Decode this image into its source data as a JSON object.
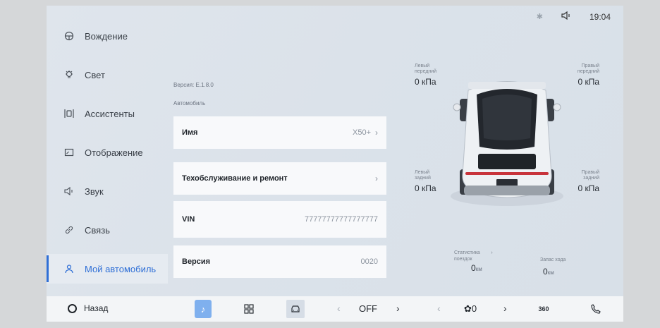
{
  "status": {
    "time": "19:04",
    "bluetooth_icon": "bluetooth-icon",
    "volume_icon": "volume-icon"
  },
  "sidebar": {
    "items": [
      {
        "label": "Вождение",
        "icon": "steering-wheel-icon"
      },
      {
        "label": "Свет",
        "icon": "light-bulb-icon"
      },
      {
        "label": "Ассистенты",
        "icon": "assistant-icon"
      },
      {
        "label": "Отображение",
        "icon": "display-icon"
      },
      {
        "label": "Звук",
        "icon": "speaker-icon"
      },
      {
        "label": "Связь",
        "icon": "link-icon"
      },
      {
        "label": "Мой автомобиль",
        "icon": "user-icon",
        "active": true
      }
    ]
  },
  "content": {
    "version_caption": "Версия: E.1.8.0",
    "section_caption": "Автомобиль",
    "rows": [
      {
        "title": "Имя",
        "value": "X50+",
        "chevron": true
      },
      {
        "title": "Техобслуживание и ремонт",
        "value": "",
        "chevron": true
      },
      {
        "title": "VIN",
        "value": "77777777777777777",
        "chevron": false
      },
      {
        "title": "Версия",
        "value": "0020",
        "chevron": false
      }
    ]
  },
  "tires": {
    "front_left": {
      "label1": "Левый",
      "label2": "передний",
      "value": "0 кПа"
    },
    "front_right": {
      "label1": "Правый",
      "label2": "передний",
      "value": "0 кПа"
    },
    "rear_left": {
      "label1": "Левый",
      "label2": "задний",
      "value": "0 кПа"
    },
    "rear_right": {
      "label1": "Правый",
      "label2": "задний",
      "value": "0 кПа"
    }
  },
  "stats": {
    "trip": {
      "label1": "Статистика",
      "label2": "поездок",
      "value": "0",
      "unit": "км"
    },
    "range": {
      "label": "Запас хода",
      "value": "0",
      "unit": "км"
    }
  },
  "dock": {
    "back_label": "Назад",
    "climate_mode": "OFF",
    "fan_value": "0",
    "view_360": "360",
    "colors": {
      "accent": "#2f6fd6",
      "music_bg": "#7fb0ee"
    }
  }
}
